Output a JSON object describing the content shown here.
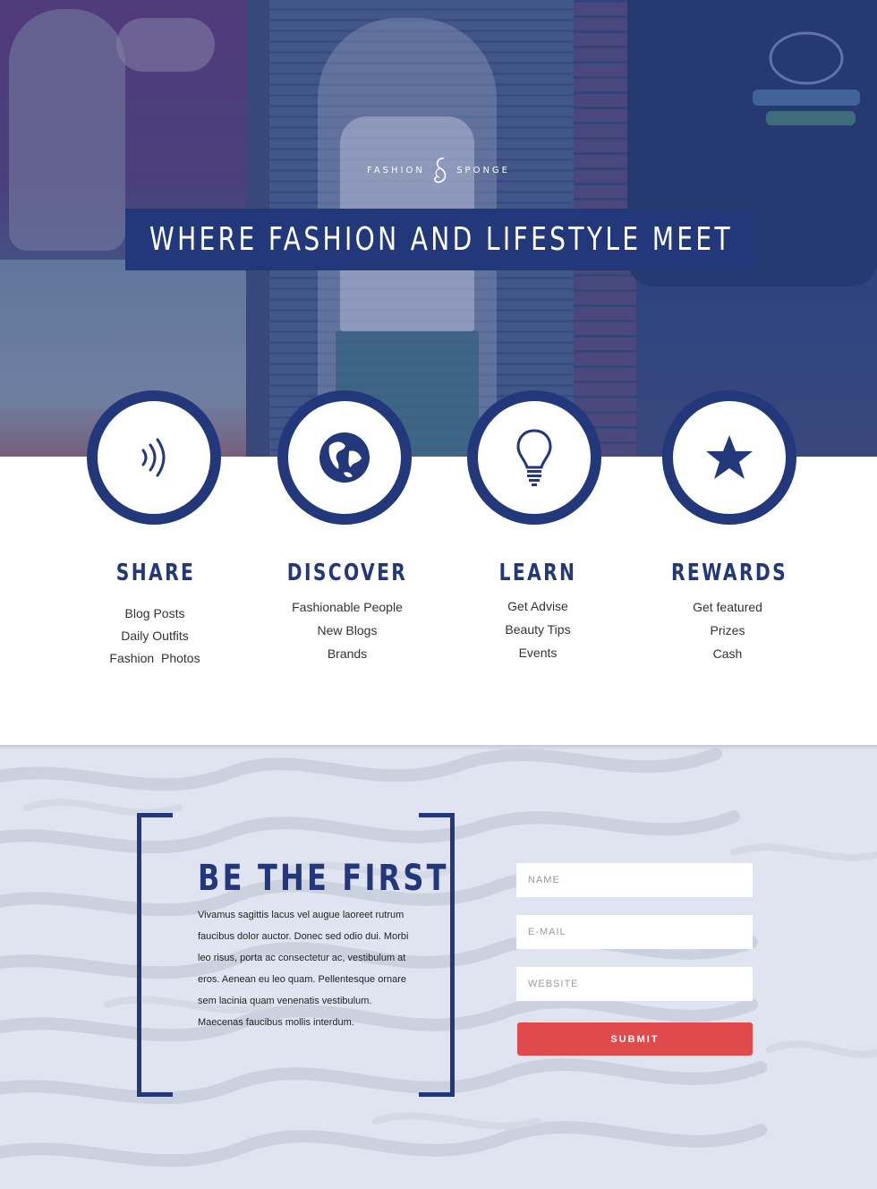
{
  "brand": {
    "left_word": "FASHION",
    "right_word": "SPONGE"
  },
  "hero": {
    "headline": "WHERE FASHION AND LIFESTYLE MEET"
  },
  "features": [
    {
      "title": "SHARE",
      "icon": "wifi-signal-icon",
      "items": [
        "Blog Posts",
        "Daily Outfits",
        "Fashion  Photos"
      ]
    },
    {
      "title": "DISCOVER",
      "icon": "globe-icon",
      "items": [
        "Fashionable People",
        "New Blogs",
        "Brands"
      ]
    },
    {
      "title": "LEARN",
      "icon": "lightbulb-icon",
      "items": [
        "Get Advise",
        "Beauty Tips",
        "Events"
      ]
    },
    {
      "title": "REWARDS",
      "icon": "star-icon",
      "items": [
        "Get featured",
        "Prizes",
        "Cash"
      ]
    }
  ],
  "signup": {
    "title": "BE THE FIRST",
    "body": "Vivamus sagittis lacus vel augue laoreet rutrum faucibus dolor auctor. Donec sed odio dui. Morbi leo risus, porta ac consectetur ac, vestibulum at eros. Aenean eu leo quam. Pellentesque ornare sem lacinia quam venenatis vestibulum. Maecenas faucibus mollis interdum.",
    "fields": {
      "name_placeholder": "NAME",
      "email_placeholder": "E-MAIL",
      "website_placeholder": "WEBSITE"
    },
    "submit_label": "SUBMIT"
  },
  "colors": {
    "navy": "#22387a",
    "submit_red": "#e14a4c",
    "signup_bg": "#dfe4f0"
  }
}
